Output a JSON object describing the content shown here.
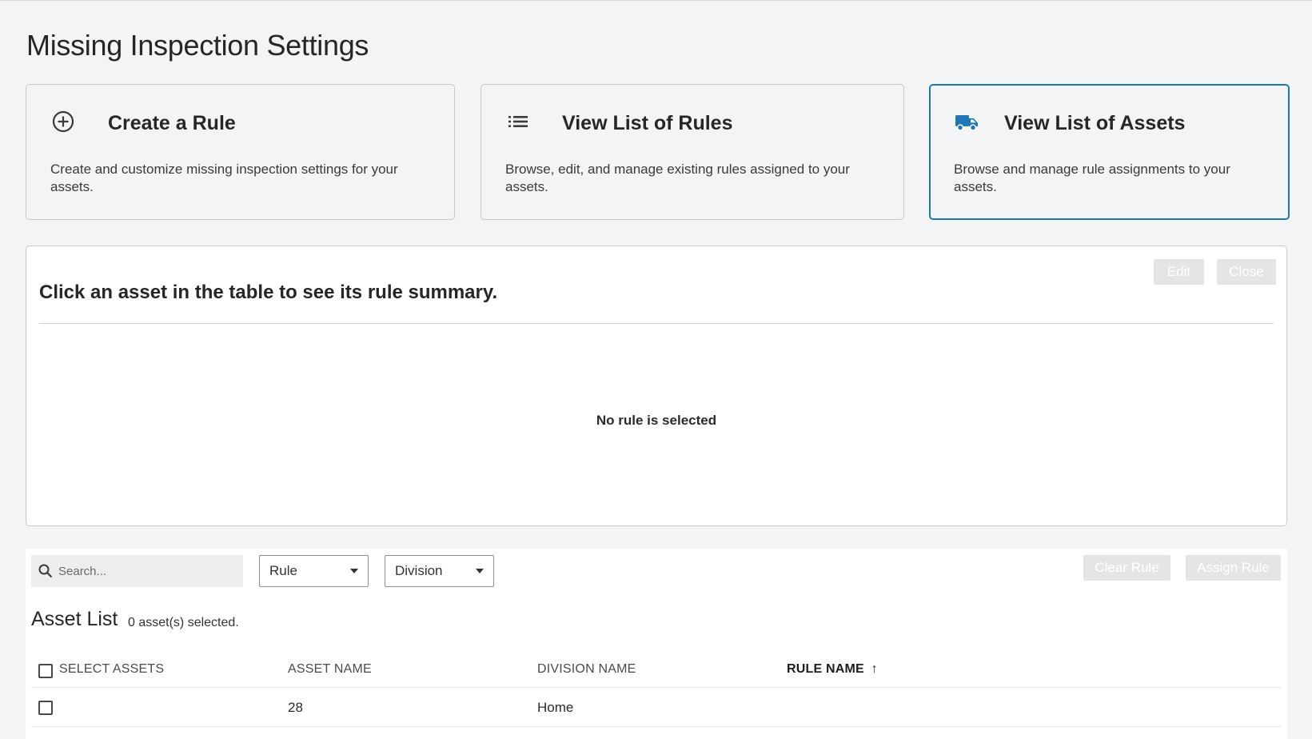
{
  "page": {
    "title": "Missing Inspection Settings"
  },
  "cards": [
    {
      "title": "Create a Rule",
      "description": "Create and customize missing inspection settings for your assets.",
      "icon": "add-circle-icon"
    },
    {
      "title": "View List of Rules",
      "description": "Browse, edit, and manage existing rules assigned to your assets.",
      "icon": "list-icon"
    },
    {
      "title": "View List of Assets",
      "description": "Browse and manage rule assignments to your assets.",
      "icon": "truck-icon",
      "active": true
    }
  ],
  "colors": {
    "accent": "#1f77b4",
    "disabled_button": "#e4e5e7",
    "background": "#f3f4f5"
  },
  "summary": {
    "heading": "Click an asset in the table to see its rule summary.",
    "empty_text": "No rule is selected",
    "edit_label": "Edit",
    "close_label": "Close"
  },
  "toolbar": {
    "search_placeholder": "Search...",
    "rule_filter": "Rule",
    "division_filter": "Division",
    "clear_rule_label": "Clear Rule",
    "assign_rule_label": "Assign Rule"
  },
  "asset_list": {
    "title": "Asset List",
    "selection_count": "0 asset(s) selected.",
    "columns": [
      "SELECT ASSETS",
      "ASSET NAME",
      "DIVISION NAME",
      "RULE NAME"
    ],
    "sort_indicator": "↑",
    "rows": [
      {
        "asset_name": "28",
        "division_name": "Home",
        "rule_name": ""
      }
    ]
  }
}
